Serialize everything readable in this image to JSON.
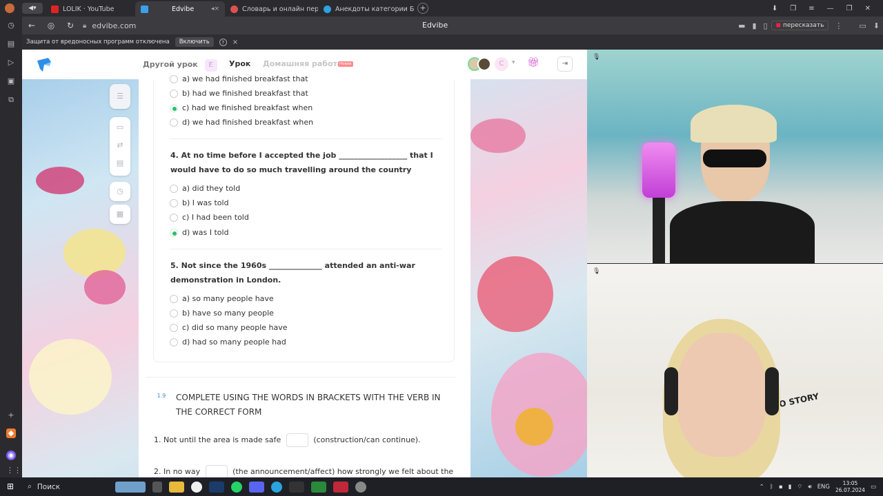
{
  "tabs": [
    {
      "title": "LOLIK · YouTube",
      "fav": "#e02424"
    },
    {
      "title": "Edvibe",
      "fav": "#3aa0e8",
      "active": true
    },
    {
      "title": "Словарь и онлайн перев…",
      "fav": "#d9534f"
    },
    {
      "title": "Анекдоты категории Б+",
      "fav": "#2aa3e0"
    }
  ],
  "browser": {
    "url": "edvibe.com",
    "page_title": "Edvibe",
    "retell_label": "пересказать",
    "security_text": "Защита от вредоносных программ отключена",
    "enable_label": "Включить"
  },
  "header": {
    "nav_other": "Другой урок",
    "nav_other_badge": "E",
    "nav_lesson": "Урок",
    "nav_homework": "Домашняя работа",
    "new_badge": "Новое",
    "avatar_letter": "C"
  },
  "questions": {
    "q3": {
      "options": [
        {
          "text": "a) we had finished breakfast that",
          "selected": false
        },
        {
          "text": "b) had we finished breakfast that",
          "selected": false
        },
        {
          "text": "c) had we finished breakfast when",
          "selected": true
        },
        {
          "text": "d) we had finished breakfast when",
          "selected": false
        }
      ]
    },
    "q4": {
      "line1": "4. At no time before I accepted the job __________________ that I",
      "line2": "would have to do so much travelling around the country",
      "options": [
        {
          "text": "a) did they told",
          "selected": false
        },
        {
          "text": "b) I was told",
          "selected": false
        },
        {
          "text": "c) I had been told",
          "selected": false
        },
        {
          "text": "d) was I told",
          "selected": true
        }
      ]
    },
    "q5": {
      "line1": "5. Not since the 1960s ______________ attended an anti-war",
      "line2": "demonstration in London.",
      "options": [
        {
          "text": "a) so many people have",
          "selected": false
        },
        {
          "text": "b) have so many people",
          "selected": false
        },
        {
          "text": "c) did so many people have",
          "selected": false
        },
        {
          "text": "d) had so many people had",
          "selected": false
        }
      ]
    }
  },
  "section": {
    "number": "1.9",
    "title_line1": "COMPLETE USING THE WORDS IN BRACKETS WITH THE VERB IN",
    "title_line2": "THE CORRECT FORM",
    "item1_pre": "1. Not until the area is made safe",
    "item1_post": "(construction/can continue).",
    "item2_pre": "2. In no way",
    "item2_post": "(the announcement/affect) how strongly we felt about the"
  },
  "video": {
    "poster_text": "NO STORY"
  },
  "taskbar": {
    "search_label": "Поиск",
    "lang": "ENG",
    "time": "13:05",
    "date": "26.07.2024"
  }
}
